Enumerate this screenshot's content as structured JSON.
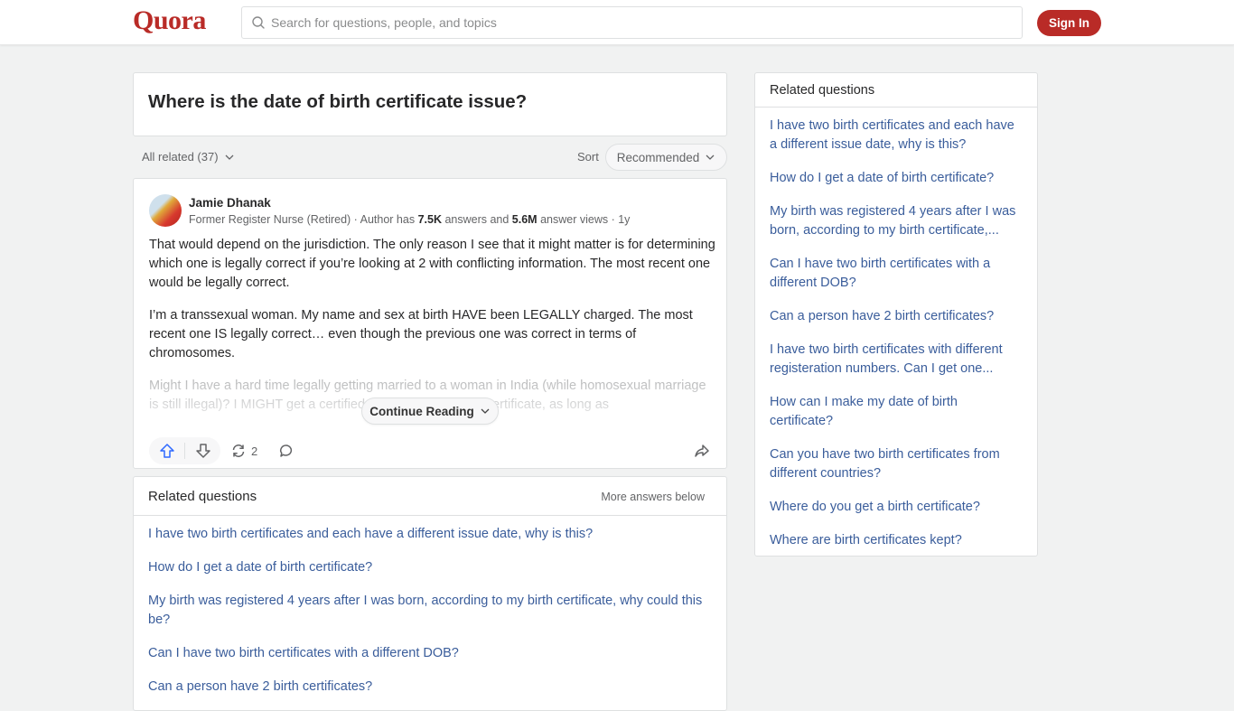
{
  "header": {
    "logo": "Quora",
    "search_placeholder": "Search for questions, people, and topics",
    "signin_label": "Sign In",
    "brand_color": "#b92b27"
  },
  "question": {
    "title": "Where is the date of birth certificate issue?"
  },
  "filters": {
    "all_related": "All related (37)",
    "sort_label": "Sort",
    "sort_value": "Recommended"
  },
  "answer": {
    "author": "Jamie Dhanak",
    "credential": "Former Register Nurse (Retired) · Author has ",
    "answers_count": "7.5K",
    "answers_text": " answers and ",
    "views_count": "5.6M",
    "views_text": " answer views · 1y",
    "paragraphs": [
      "That would depend on the jurisdiction. The only reason I see that it might matter is for determining which one is legally correct if you’re looking at 2 with conflicting information. The most recent one would be legally correct.",
      "I’m a transsexual woman. My name and sex at birth HAVE been LEGALLY charged. The most recent one IS legally correct… even though the previous one was correct in terms of chromosomes."
    ],
    "faded_paragraph": "Might I have a hard time legally getting married to a woman in India (while homosexual marriage is still illegal)? I MIGHT get a certified copy of my old birth certificate, as long as",
    "continue_label": "Continue Reading",
    "share_count": "2"
  },
  "related_main": {
    "title": "Related questions",
    "more_label": "More answers below",
    "items": [
      "I have two birth certificates and each have a different issue date, why is this?",
      "How do I get a date of birth certificate?",
      "My birth was registered 4 years after I was born, according to my birth certificate, why could this be?",
      "Can I have two birth certificates with a different DOB?",
      "Can a person have 2 birth certificates?"
    ]
  },
  "related_side": {
    "title": "Related questions",
    "items": [
      "I have two birth certificates and each have a different issue date, why is this?",
      "How do I get a date of birth certificate?",
      "My birth was registered 4 years after I was born, according to my birth certificate,...",
      "Can I have two birth certificates with a different DOB?",
      "Can a person have 2 birth certificates?",
      "I have two birth certificates with different registeration numbers. Can I get one...",
      "How can I make my date of birth certificate?",
      "Can you have two birth certificates from different countries?",
      "Where do you get a birth certificate?",
      "Where are birth certificates kept?"
    ]
  }
}
